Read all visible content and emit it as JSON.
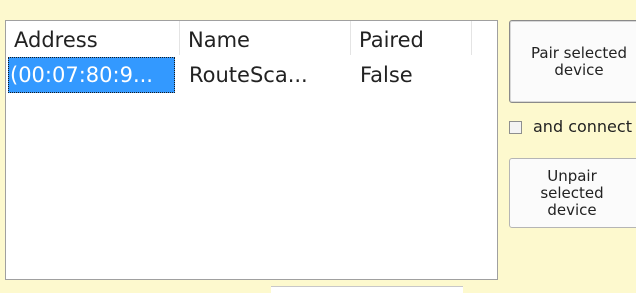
{
  "devices_list": {
    "columns": [
      {
        "label": "Address"
      },
      {
        "label": "Name"
      },
      {
        "label": "Paired"
      }
    ],
    "rows": [
      {
        "address": "(00:07:80:9...",
        "name": "RouteSca...",
        "paired": "False"
      }
    ]
  },
  "buttons": {
    "pair_label": "Pair selected device",
    "unpair_label": "Unpair selected device"
  },
  "connect_checkbox": {
    "label": "and connect",
    "checked": false
  },
  "colors": {
    "window_background": "#fdf9ce",
    "selection_background": "#3399ff"
  }
}
